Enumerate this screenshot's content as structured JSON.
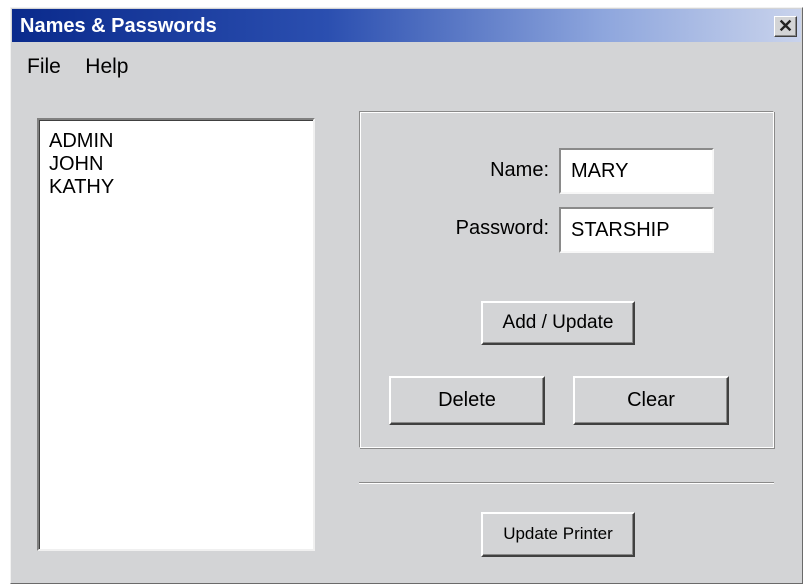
{
  "window": {
    "title": "Names & Passwords",
    "close_glyph": "✕"
  },
  "menu": {
    "items": [
      {
        "label": "File"
      },
      {
        "label": "Help"
      }
    ]
  },
  "user_list": {
    "items": [
      "ADMIN",
      "JOHN",
      "KATHY"
    ]
  },
  "form": {
    "name_label": "Name:",
    "name_value": "MARY",
    "password_label": "Password:",
    "password_value": "STARSHIP"
  },
  "buttons": {
    "add_update": "Add / Update",
    "delete": "Delete",
    "clear": "Clear",
    "update_printer": "Update Printer"
  },
  "colors": {
    "titlebar_start": "#0a2a8c",
    "titlebar_end": "#c9d3ec",
    "window_face": "#d3d4d6"
  }
}
